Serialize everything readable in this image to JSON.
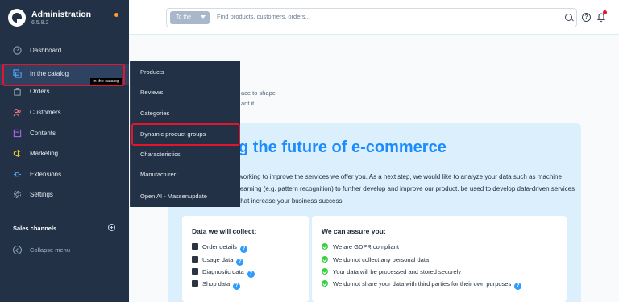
{
  "brand": {
    "title": "Administration",
    "version": "6.5.8.2"
  },
  "nav": [
    {
      "label": "Dashboard",
      "icon": "dashboard-icon"
    },
    {
      "label": "In the catalog",
      "icon": "catalog-icon"
    },
    {
      "label": "Orders",
      "icon": "orders-icon"
    },
    {
      "label": "Customers",
      "icon": "customers-icon"
    },
    {
      "label": "Contents",
      "icon": "contents-icon"
    },
    {
      "label": "Marketing",
      "icon": "marketing-icon"
    },
    {
      "label": "Extensions",
      "icon": "extensions-icon"
    },
    {
      "label": "Settings",
      "icon": "settings-icon"
    }
  ],
  "tooltip": "In the catalog",
  "flyout": [
    "Products",
    "Reviews",
    "Categories",
    "Dynamic product groups",
    "Characteristics",
    "Manufacturer",
    "Open AI - Massenupdate"
  ],
  "sidebar_footer": {
    "sales_channels": "Sales channels",
    "collapse": "Collapse menu"
  },
  "search": {
    "scope": "To the",
    "placeholder": "Find products, customers, orders..."
  },
  "intro": {
    "line1": "ace to shape",
    "line2": "ant it."
  },
  "banner": {
    "headline": "g the future of e-commerce",
    "body": "working to improve the services we offer you. As a next step, we would like to analyze your data such as machine learning (e.g. pattern recognition) to further develop and improve our product. be used to develop data-driven services that increase your business success."
  },
  "collect": {
    "title": "Data we will collect:",
    "items": [
      "Order details",
      "Usage data",
      "Diagnostic data",
      "Shop data"
    ]
  },
  "assure": {
    "title": "We can assure you:",
    "items": [
      "We are GDPR compliant",
      "We do not collect any personal data",
      "Your data will be processed and stored securely",
      "We do not share your data with third parties for their own purposes"
    ]
  },
  "colors": {
    "sidebar": "#223145",
    "accent": "#1a8cff",
    "highlight": "#e1152b",
    "check": "#37d046"
  }
}
